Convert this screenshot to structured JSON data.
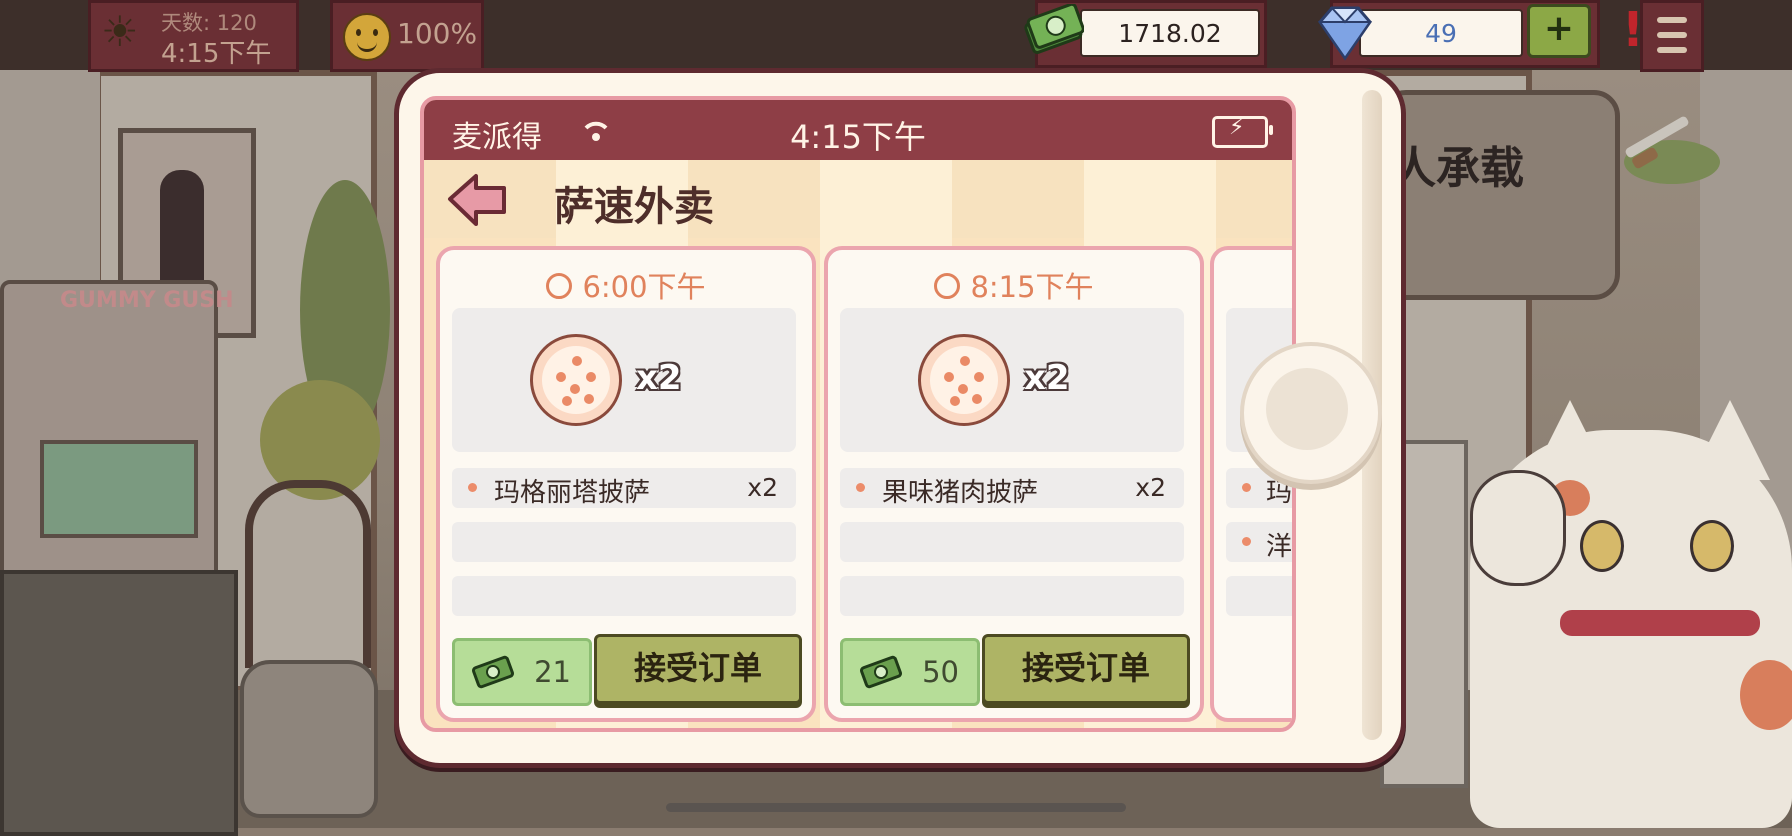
{
  "hud": {
    "day_label": "天数: 120",
    "day_time": "4:15下午",
    "mood": "100%",
    "money": "1718.02",
    "gems": "49",
    "plus_label": "+",
    "alert_label": "!"
  },
  "background": {
    "arcade_title": "GUMMY GUSH",
    "sign_text": "人承载"
  },
  "phone": {
    "carrier": "麦派得",
    "clock": "4:15下午",
    "app_title": "萨速外卖",
    "orders": [
      {
        "time": "6:00下午",
        "pizza_qty": "x2",
        "items": [
          {
            "name": "玛格丽塔披萨",
            "qty": "x2"
          }
        ],
        "reward": "21",
        "accept_label": "接受订单"
      },
      {
        "time": "8:15下午",
        "pizza_qty": "x2",
        "items": [
          {
            "name": "果味猪肉披萨",
            "qty": "x2"
          }
        ],
        "reward": "50",
        "accept_label": "接受订单"
      }
    ],
    "peek_items": [
      "玛",
      "洋"
    ]
  },
  "colors": {
    "status_bar": "#8e3e46",
    "card_border": "#eba5ae",
    "accept_button": "#aeb465",
    "reward_box": "#b6dd98",
    "time_accent": "#e0825c"
  },
  "icons": [
    "sun-moon-icon",
    "smile-icon",
    "cash-icon",
    "gem-icon",
    "plus-icon",
    "alert-icon",
    "menu-icon",
    "wifi-icon",
    "battery-icon",
    "back-arrow-icon",
    "clock-icon",
    "pizza-icon"
  ]
}
